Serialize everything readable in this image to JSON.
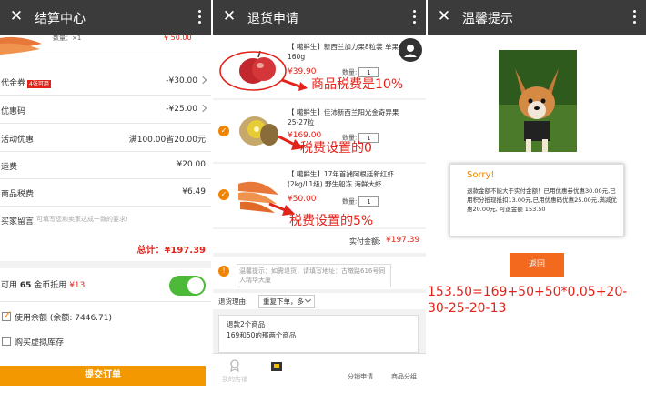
{
  "checkout": {
    "title": "结算中心",
    "qty_label": "数量：×1",
    "top_price": "¥ 50.00",
    "coupon": {
      "label": "代金券",
      "tag": "4张可用",
      "value": "-¥30.00"
    },
    "promo_code": {
      "label": "优惠码",
      "value": "-¥25.00"
    },
    "activity": {
      "label": "活动优惠",
      "value": "满100.00省20.00元"
    },
    "shipping": {
      "label": "运费",
      "value": "¥20.00"
    },
    "tax": {
      "label": "商品税费",
      "value": "¥6.49"
    },
    "buyer_note": {
      "label": "买家留言:",
      "placeholder": "可填写您和卖家达成一致的要求!"
    },
    "total": "总计：¥197.39",
    "coins": {
      "prefix": "可用",
      "count": "65",
      "suffix": "金币抵用",
      "amount": "¥13"
    },
    "balance": "使用余额 (余额: 7446.71)",
    "virtual_stock": "购买虚拟库存",
    "submit": "提交订单"
  },
  "refund": {
    "title": "退货申请",
    "items": [
      {
        "name": "【 噶鲜生】新西兰加力果8粒装 单果160g",
        "price": "¥39.90",
        "qty_label": "数量:",
        "qty": "1"
      },
      {
        "name": "【 噶鲜生】佳沛新西兰阳光金奇异果 25-27粒",
        "price": "¥169.00",
        "qty_label": "数量:",
        "qty": "1"
      },
      {
        "name": "【 噶鲜生】17年首捕阿根廷新红虾(2kg/L1级) 野生船冻 海鲜大虾",
        "price": "¥50.00",
        "qty_label": "数量:",
        "qty": "1"
      }
    ],
    "annotations": [
      "商品税费是10%",
      "税费设置的0",
      "税费设置的5%"
    ],
    "refund_amount_label": "实付金额:",
    "refund_amount": "¥197.39",
    "notice": "温馨提示：如需退货，请填写地址：古墩路616号同人精华大厦",
    "reason_label": "退货理由:",
    "reason_value": "重复下单，多",
    "description": [
      "退款2个商品",
      "169和50的那两个商品"
    ],
    "tabs": [
      "我的店铺",
      "",
      "",
      "分销申请",
      "商品分组"
    ]
  },
  "notice_dialog": {
    "title": "温馨提示",
    "heading": "Sorry!",
    "message": "退款金额不能大于实付金额！已用优惠券优惠30.00元,已用积分抵现抵扣13.00元,已用优惠码优惠25.00元,满减优惠20.00元, 可退金额 153.50",
    "return_button": "返回",
    "formula": "153.50=169+50+50*0.05+20-30-25-20-13"
  },
  "colors": {
    "accent": "#f08300",
    "red": "#e2231a",
    "topbar": "#3b3b3b",
    "green": "#4cba38"
  }
}
